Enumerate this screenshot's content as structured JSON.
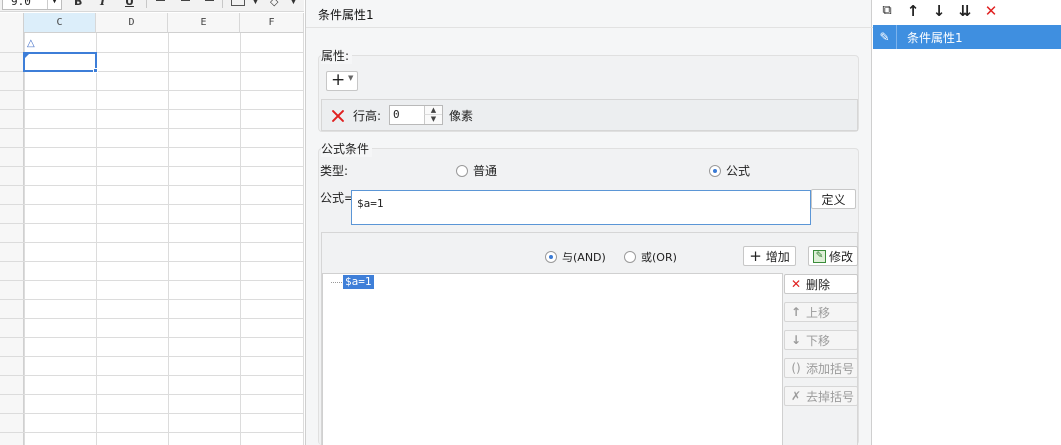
{
  "sheet": {
    "font_size_value": "9.0",
    "bold_label": "B",
    "italic_label": "I",
    "underline_label": "U",
    "columns": [
      "C",
      "D",
      "E",
      "F"
    ],
    "selected_column": "C",
    "condition_marker": "△"
  },
  "dialog": {
    "title": "条件属性1",
    "properties": {
      "group_label": "属性:",
      "add_label": "+",
      "row_height_label": "行高:",
      "row_height_value": "0",
      "row_height_unit": "像素"
    },
    "formula_condition": {
      "group_label": "公式条件",
      "type_label": "类型:",
      "type_options": [
        "普通",
        "公式"
      ],
      "type_selected": "公式",
      "formula_label": "公式=",
      "formula_value": "$a=1",
      "define_button": "定义",
      "logic_options": [
        "与(AND)",
        "或(OR)"
      ],
      "logic_selected": "与(AND)",
      "add_button": "增加",
      "modify_button": "修改",
      "conditions": [
        "$a=1"
      ],
      "side_buttons": [
        {
          "label": "删除",
          "icon": "x-icon",
          "enabled": true
        },
        {
          "label": "上移",
          "icon": "arrow-up-icon",
          "enabled": false
        },
        {
          "label": "下移",
          "icon": "arrow-down-icon",
          "enabled": false
        },
        {
          "label": "添加括号",
          "icon": "parentheses-icon",
          "enabled": false
        },
        {
          "label": "去掉括号",
          "icon": "remove-parentheses-icon",
          "enabled": false
        }
      ]
    }
  },
  "right_panel": {
    "toolbar_icons": [
      "copy-icon",
      "arrow-up-icon",
      "arrow-down-icon",
      "sort-down-icon",
      "delete-icon"
    ],
    "items": [
      {
        "label": "条件属性1",
        "selected": true
      }
    ]
  },
  "colors": {
    "accent": "#3f8fe0",
    "selection": "#3d7ed8",
    "delete_red": "#e02020"
  }
}
